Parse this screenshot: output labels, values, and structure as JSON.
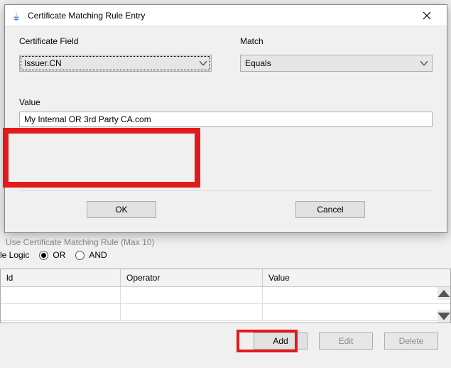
{
  "dialog": {
    "title": "Certificate Matching Rule Entry",
    "cert_field_label": "Certificate Field",
    "match_label": "Match",
    "cert_field_value": "Issuer.CN",
    "match_value": "Equals",
    "value_label": "Value",
    "value_text": "My Internal OR 3rd Party CA.com",
    "ok": "OK",
    "cancel": "Cancel"
  },
  "bg": {
    "section_label": "Use Certificate Matching Rule (Max 10)",
    "logic_label": "le Logic",
    "or_label": "OR",
    "and_label": "AND",
    "table_headers": {
      "c1": "ld",
      "c2": "Operator",
      "c3": "Value"
    },
    "buttons": {
      "add": "Add",
      "edit": "Edit",
      "delete": "Delete"
    }
  }
}
